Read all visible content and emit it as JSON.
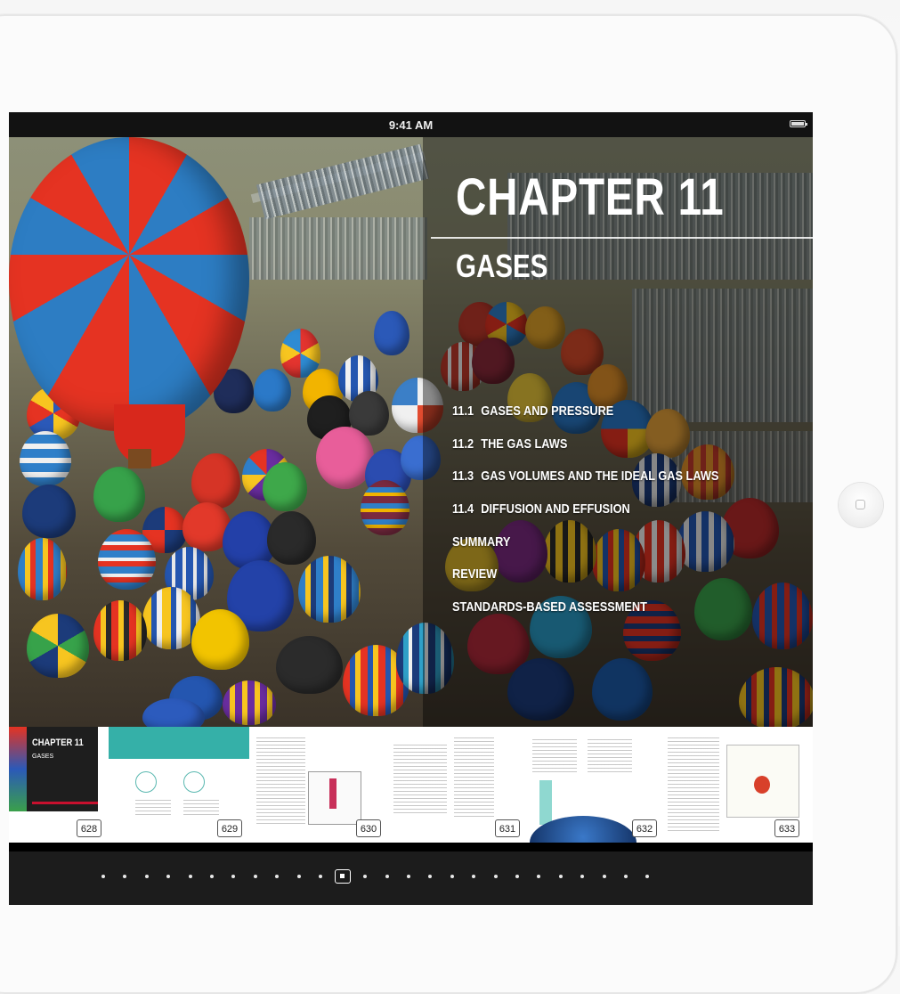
{
  "status_bar": {
    "time": "9:41 AM"
  },
  "chapter": {
    "title": "CHAPTER 11",
    "subtitle": "GASES"
  },
  "toc": [
    {
      "num": "11.1",
      "label": "GASES AND PRESSURE"
    },
    {
      "num": "11.2",
      "label": "THE GAS LAWS"
    },
    {
      "num": "11.3",
      "label": "GAS VOLUMES AND THE IDEAL GAS LAWS"
    },
    {
      "num": "11.4",
      "label": "DIFFUSION AND EFFUSION"
    },
    {
      "num": "",
      "label": "SUMMARY"
    },
    {
      "num": "",
      "label": "REVIEW"
    },
    {
      "num": "",
      "label": "STANDARDS-BASED ASSESSMENT"
    }
  ],
  "page_strip": {
    "first_thumb": {
      "title": "CHAPTER 11",
      "subtitle": "GASES"
    },
    "pages": [
      "628",
      "629",
      "630",
      "631",
      "632",
      "633"
    ]
  },
  "page_dots": {
    "count": 26,
    "current_index": 11
  },
  "icons": {
    "home": "home-button-icon",
    "battery": "battery-icon"
  }
}
